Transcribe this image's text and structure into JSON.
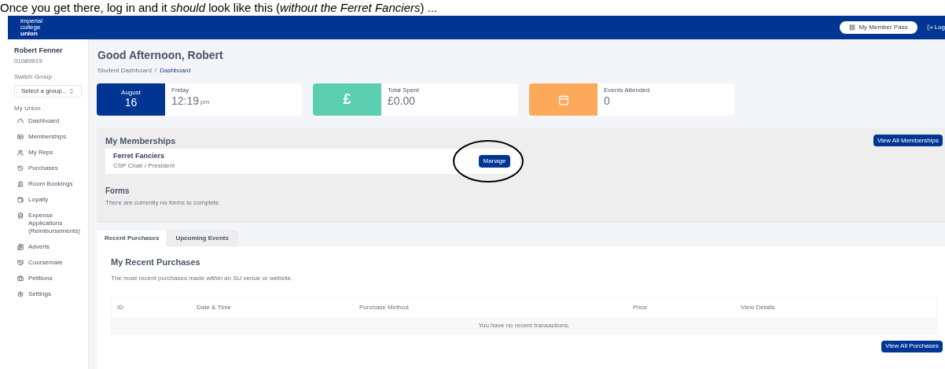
{
  "caption": "Once you get there, log in and it *should* look like this (*without the Ferret Fanciers*) ...",
  "topbar": {
    "logo_lines": [
      "imperial",
      "college",
      "union"
    ],
    "member_pass": "My Member Pass",
    "logout": "Log"
  },
  "sidebar": {
    "user_name": "Robert Fenner",
    "user_id": "01089919",
    "switch_label": "Switch Group",
    "select_placeholder": "Select a group...",
    "section": "My Union",
    "items": [
      {
        "label": "Dashboard"
      },
      {
        "label": "Memberships"
      },
      {
        "label": "My Reps"
      },
      {
        "label": "Purchases"
      },
      {
        "label": "Room Bookings"
      },
      {
        "label": "Loyalty"
      },
      {
        "label": "Expense Applications (Reimbursements)"
      },
      {
        "label": "Adverts"
      },
      {
        "label": "Coursemate"
      },
      {
        "label": "Petitions"
      },
      {
        "label": "Settings"
      }
    ]
  },
  "greeting": "Good Afternoon, Robert",
  "breadcrumb": {
    "separator": "/",
    "items": [
      {
        "label": "Student Dashboard",
        "selected": false
      },
      {
        "label": "Dashboard",
        "selected": true
      }
    ]
  },
  "stats": [
    {
      "kind": "date",
      "month": "August",
      "day": "16",
      "label": "Friday",
      "value": "12:19",
      "suffix": "pm",
      "color": "#003594"
    },
    {
      "kind": "pound",
      "glyph": "£",
      "label": "Total Spent",
      "value": "£0.00",
      "color": "#5bcfb0"
    },
    {
      "kind": "calendar",
      "label": "Events Attended",
      "value": "0",
      "color": "#fca95c"
    }
  ],
  "memberships": {
    "title": "My Memberships",
    "view_all": "View All Memberships",
    "items": [
      {
        "name": "Ferret Fanciers",
        "role": "CSP Chair / President",
        "action": "Manage",
        "circled": true
      }
    ]
  },
  "forms": {
    "title": "Forms",
    "empty": "There are currently no forms to complete"
  },
  "tabs": [
    {
      "label": "Recent Purchases",
      "selected": true
    },
    {
      "label": "Upcoming Events",
      "selected": false
    }
  ],
  "purchases": {
    "title": "My Recent Purchases",
    "description": "The most recent purchases made within an SU venue or website.",
    "columns": [
      "ID",
      "Date & Time",
      "Purchase Method",
      "Price",
      "View Details"
    ],
    "empty": "You have no recent transactions.",
    "view_all": "View All Purchases"
  }
}
